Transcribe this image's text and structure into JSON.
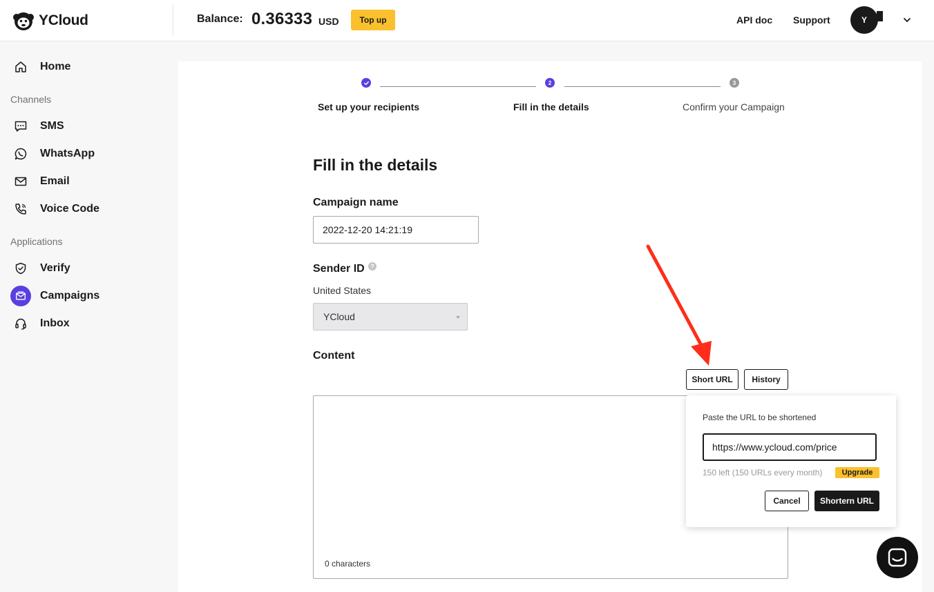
{
  "header": {
    "logo_text": "YCloud",
    "balance_label": "Balance:",
    "balance_value": "0.36333",
    "balance_unit": "USD",
    "topup_label": "Top up",
    "api_doc_label": "API doc",
    "support_label": "Support",
    "avatar_initial": "Y"
  },
  "sidebar": {
    "home": "Home",
    "section_channels": "Channels",
    "channels": [
      "SMS",
      "WhatsApp",
      "Email",
      "Voice Code"
    ],
    "section_applications": "Applications",
    "applications": [
      "Verify",
      "Campaigns",
      "Inbox"
    ],
    "active_item": "Campaigns"
  },
  "stepper": {
    "steps": [
      {
        "label": "Set up your recipients",
        "state": "done"
      },
      {
        "label": "Fill in the details",
        "state": "active",
        "number": "2"
      },
      {
        "label": "Confirm your Campaign",
        "state": "pending",
        "number": "3"
      }
    ]
  },
  "form": {
    "heading": "Fill in the details",
    "campaign_name_label": "Campaign name",
    "campaign_name_value": "2022-12-20 14:21:19",
    "sender_id_label": "Sender ID",
    "help_glyph": "?",
    "country": "United States",
    "sender_selected": "YCloud",
    "content_label": "Content",
    "short_url_label": "Short URL",
    "history_label": "History",
    "char_count": "0 characters"
  },
  "popover": {
    "title": "Paste the URL to be shortened",
    "url_value": "https://www.ycloud.com/price",
    "quota_text": "150 left (150 URLs every month)",
    "upgrade_label": "Upgrade",
    "cancel_label": "Cancel",
    "submit_label": "Shortern URL"
  },
  "colors": {
    "accent": "#5a3fe0",
    "highlight": "#fbc02d",
    "annotation": "#ff2d1a",
    "text": "#1a1a1a"
  }
}
